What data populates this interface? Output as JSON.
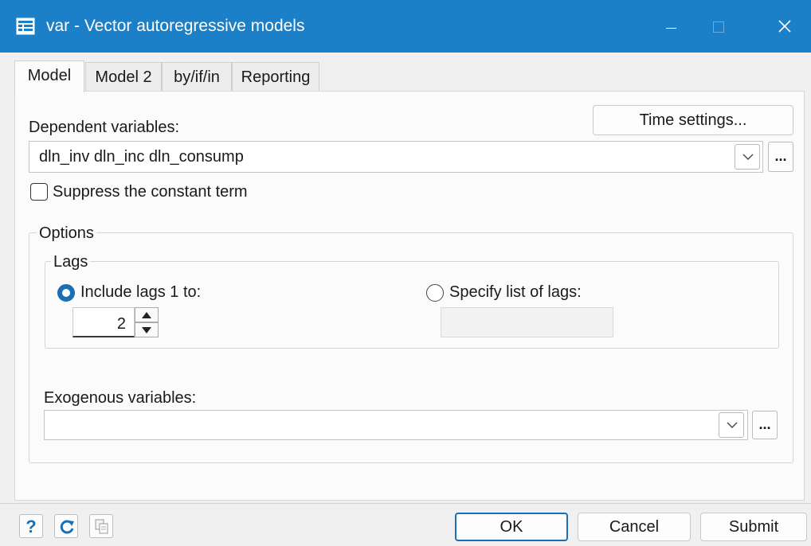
{
  "window": {
    "title": "var - Vector autoregressive models",
    "colors": {
      "titlebar": "#1b80c8",
      "accent": "#1a6fb4",
      "panel": "#fbfbfb"
    }
  },
  "tabs": [
    {
      "label": "Model",
      "active": true
    },
    {
      "label": "Model 2",
      "active": false
    },
    {
      "label": "by/if/in",
      "active": false
    },
    {
      "label": "Reporting",
      "active": false
    }
  ],
  "model": {
    "time_settings_label": "Time settings...",
    "dependent_label": "Dependent variables:",
    "dependent_value": "dln_inv dln_inc dln_consump",
    "suppress_label": "Suppress the constant term",
    "suppress_checked": false,
    "options_legend": "Options",
    "lags_legend": "Lags",
    "include_lags_label": "Include lags 1 to:",
    "include_lags_selected": true,
    "lags_value": "2",
    "specify_lags_label": "Specify list of lags:",
    "specify_lags_selected": false,
    "exogenous_label": "Exogenous variables:",
    "exogenous_value": "",
    "ellipsis": "..."
  },
  "footer": {
    "help_icon": "?",
    "ok_label": "OK",
    "cancel_label": "Cancel",
    "submit_label": "Submit"
  }
}
